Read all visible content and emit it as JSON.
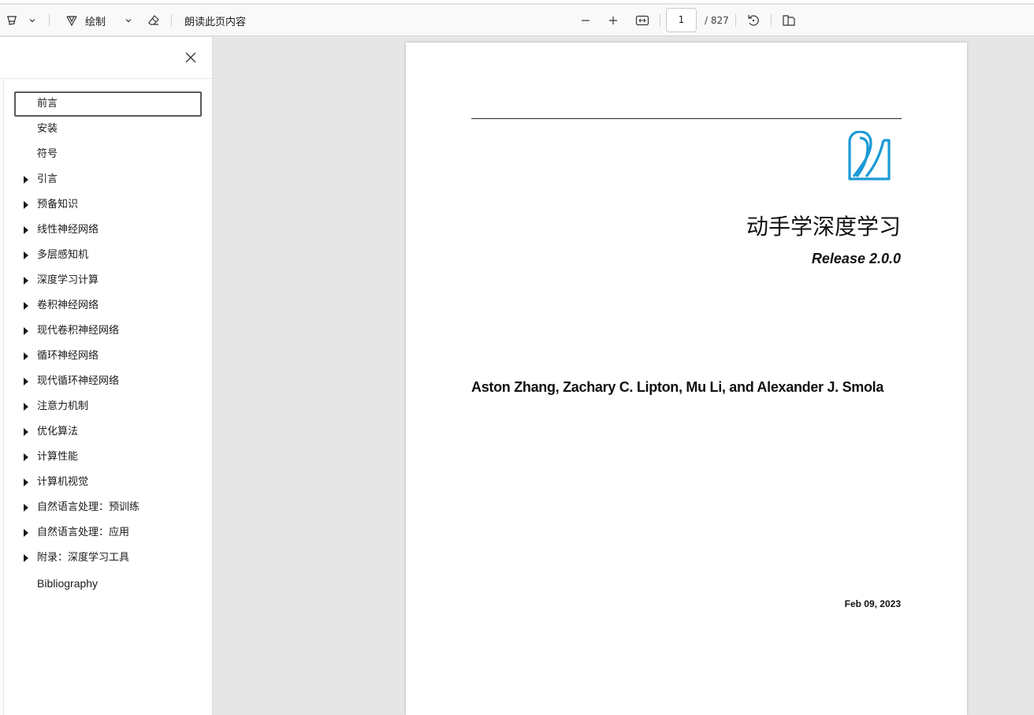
{
  "toolbar": {
    "draw_label": "绘制",
    "read_aloud_label": "朗读此页内容",
    "page_current": "1",
    "page_total": "/ 827"
  },
  "sidebar": {
    "items": [
      {
        "label": "前言",
        "expandable": false,
        "selected": true
      },
      {
        "label": "安装",
        "expandable": false
      },
      {
        "label": "符号",
        "expandable": false
      },
      {
        "label": "引言",
        "expandable": true
      },
      {
        "label": "预备知识",
        "expandable": true
      },
      {
        "label": "线性神经网络",
        "expandable": true
      },
      {
        "label": "多层感知机",
        "expandable": true
      },
      {
        "label": "深度学习计算",
        "expandable": true
      },
      {
        "label": "卷积神经网络",
        "expandable": true
      },
      {
        "label": "现代卷积神经网络",
        "expandable": true
      },
      {
        "label": "循环神经网络",
        "expandable": true
      },
      {
        "label": "现代循环神经网络",
        "expandable": true
      },
      {
        "label": "注意力机制",
        "expandable": true
      },
      {
        "label": "优化算法",
        "expandable": true
      },
      {
        "label": "计算性能",
        "expandable": true
      },
      {
        "label": "计算机视觉",
        "expandable": true
      },
      {
        "label": "自然语言处理：预训练",
        "expandable": true
      },
      {
        "label": "自然语言处理：应用",
        "expandable": true
      },
      {
        "label": "附录：深度学习工具",
        "expandable": true
      },
      {
        "label": "Bibliography",
        "expandable": false
      }
    ]
  },
  "document": {
    "title": "动手学深度学习",
    "release": "Release 2.0.0",
    "authors": "Aston Zhang, Zachary C. Lipton, Mu Li, and Alexander J. Smola",
    "date": "Feb 09, 2023"
  },
  "colors": {
    "logo": "#1a9ad6",
    "toolbar_bg": "#f9f9f9",
    "viewer_bg": "#e6e6e6"
  }
}
